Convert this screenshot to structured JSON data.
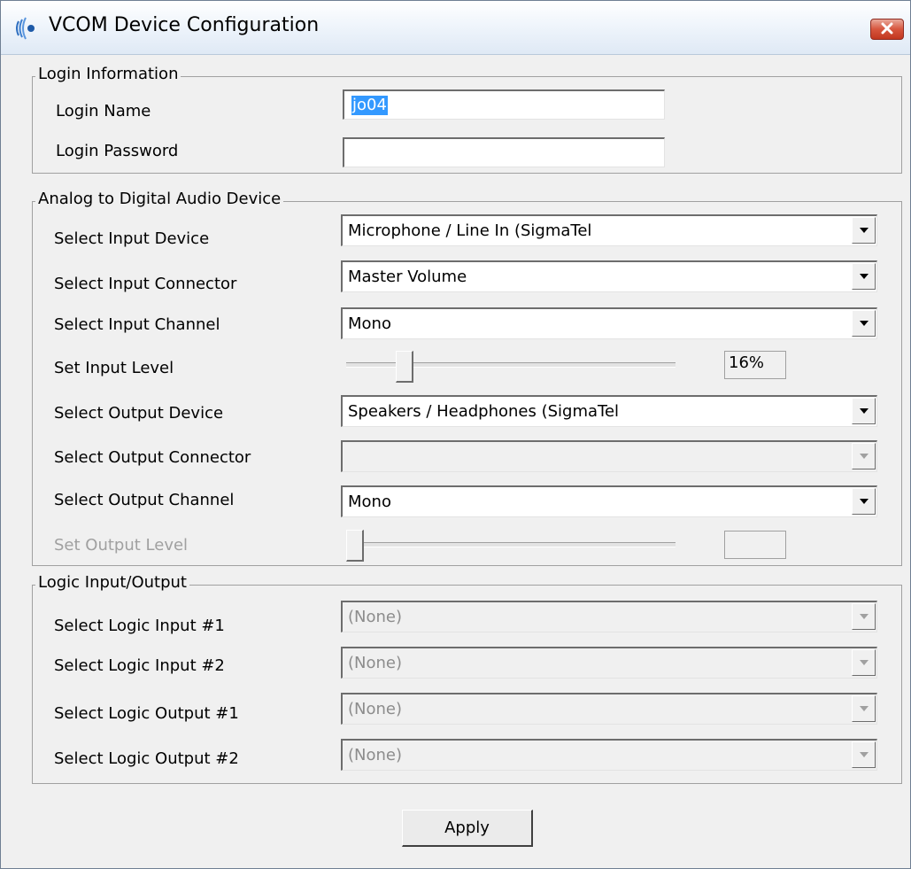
{
  "window": {
    "title": "VCOM Device Configuration",
    "close_glyph": "×"
  },
  "login": {
    "legend": "Login Information",
    "name_label": "Login Name",
    "name_value": "jo04",
    "password_label": "Login Password",
    "password_value": ""
  },
  "audio": {
    "legend": "Analog to Digital Audio Device",
    "input_device_label": "Select Input Device",
    "input_device_value": "Microphone / Line In (SigmaTel",
    "input_connector_label": "Select Input Connector",
    "input_connector_value": "Master Volume",
    "input_channel_label": "Select Input Channel",
    "input_channel_value": "Mono",
    "input_level_label": "Set Input Level",
    "input_level_percent": 16,
    "input_level_text": "16%",
    "output_device_label": "Select Output Device",
    "output_device_value": "Speakers / Headphones (SigmaTel",
    "output_connector_label": "Select Output Connector",
    "output_connector_value": "",
    "output_channel_label": "Select Output Channel",
    "output_channel_value": "Mono",
    "output_level_label": "Set Output Level",
    "output_level_percent": 0,
    "output_level_text": ""
  },
  "logic": {
    "legend": "Logic Input/Output",
    "input1_label": "Select Logic Input #1",
    "input1_value": "(None)",
    "input2_label": "Select Logic Input #2",
    "input2_value": "(None)",
    "output1_label": "Select Logic Output #1",
    "output1_value": "(None)",
    "output2_label": "Select Logic Output #2",
    "output2_value": "(None)"
  },
  "actions": {
    "apply_label": "Apply"
  },
  "colors": {
    "selection": "#3399ff",
    "disabled_text": "#a0a0a0",
    "close_red": "#c2371f"
  },
  "icons": {
    "app": "signal-waves-icon",
    "close": "close-icon",
    "dropdown": "dropdown-arrow-icon"
  }
}
